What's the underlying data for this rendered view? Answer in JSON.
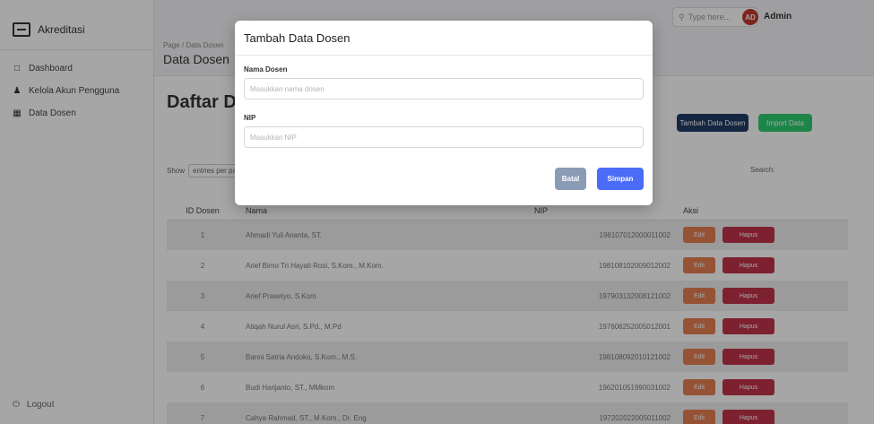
{
  "sidebar": {
    "brand": "Akreditasi",
    "items": [
      {
        "label": "Dashboard",
        "icon": "dashboard-icon"
      },
      {
        "label": "Kelola Akun Pengguna",
        "icon": "user-icon"
      },
      {
        "label": "Data Dosen",
        "icon": "table-icon"
      }
    ],
    "logout": "Logout"
  },
  "topbar": {
    "search_placeholder": "Type here...",
    "avatar_initials": "AD",
    "user_name": "Admin"
  },
  "page": {
    "breadcrumb": "Page / Data Dosen",
    "title": "Data Dosen"
  },
  "card": {
    "title": "Daftar Dosen",
    "add_button": "Tambah Data Dosen",
    "import_button": "Import Data",
    "show_label": "Show",
    "show_value": "entries per page",
    "search_label": "Search:"
  },
  "table": {
    "headers": [
      "ID Dosen",
      "Nama",
      "NIP",
      "Aksi"
    ],
    "edit_label": "Edit",
    "delete_label": "Hapus",
    "rows": [
      {
        "id": "1",
        "name": "Ahmadi Yuli Ananta, ST.",
        "nip": "196107012000011002"
      },
      {
        "id": "2",
        "name": "Arief Bimo Tri Hayati Rosi, S.Kom., M.Kom.",
        "nip": "198108102009012002"
      },
      {
        "id": "3",
        "name": "Arief Prasetyo, S.Kom",
        "nip": "197903132008121002"
      },
      {
        "id": "4",
        "name": "Atiqah Nurul Asri, S.Pd., M.Pd",
        "nip": "197606252005012001"
      },
      {
        "id": "5",
        "name": "Banni Satria Andoko, S.Kom., M.S.",
        "nip": "198108092010121002"
      },
      {
        "id": "6",
        "name": "Budi Harijanto, ST., MMkom",
        "nip": "196201051990031002"
      },
      {
        "id": "7",
        "name": "Cahya Rahmad, ST., M.Kom., Dr. Eng",
        "nip": "197202022005011002"
      }
    ]
  },
  "modal": {
    "title": "Tambah Data Dosen",
    "name_label": "Nama Dosen",
    "name_placeholder": "Masukkan nama dosen",
    "nip_label": "NIP",
    "nip_placeholder": "Masukkan NIP",
    "cancel_label": "Batal",
    "save_label": "Simpan"
  }
}
